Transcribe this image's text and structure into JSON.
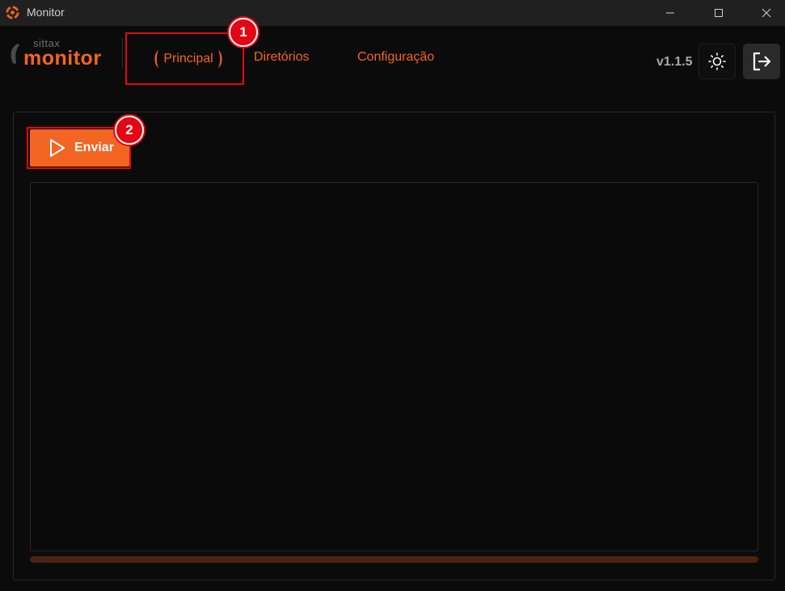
{
  "window": {
    "title": "Monitor"
  },
  "logo": {
    "small": "sittax",
    "big": "monitor"
  },
  "nav": {
    "items": [
      {
        "label": "Principal",
        "active": true
      },
      {
        "label": "Diretórios",
        "active": false
      },
      {
        "label": "Configuração",
        "active": false
      }
    ]
  },
  "annotations": {
    "badge1": "1",
    "badge2": "2"
  },
  "header": {
    "version": "v1.1.5",
    "theme_icon": "sun-icon",
    "logout_icon": "logout-icon"
  },
  "main": {
    "send_label": "Enviar",
    "send_icon": "play-icon",
    "log_text": "",
    "progress": 0
  },
  "colors": {
    "accent": "#f26522",
    "annotation": "#e30613",
    "background": "#0c0b0b"
  }
}
